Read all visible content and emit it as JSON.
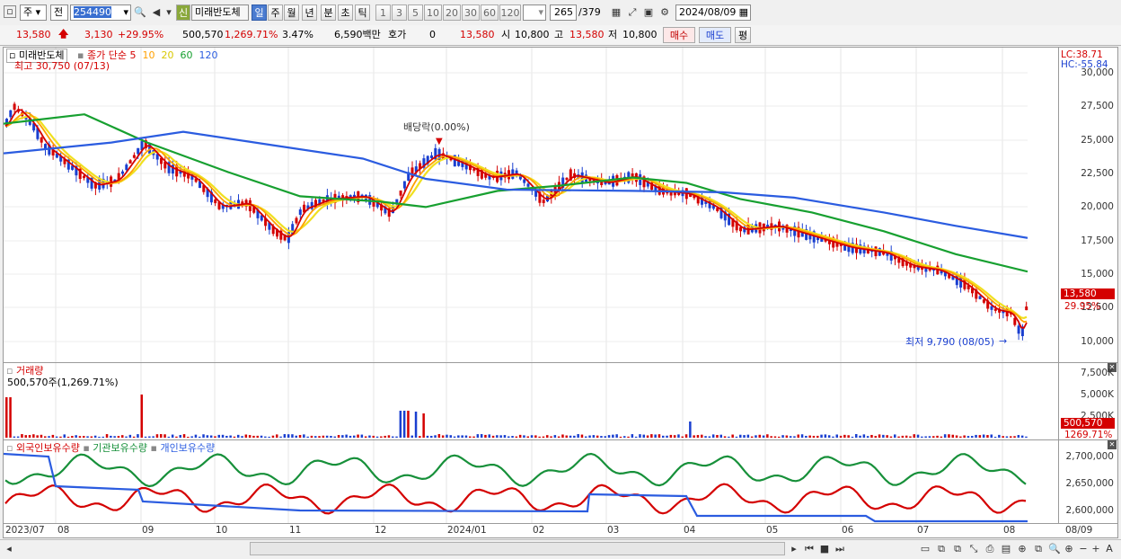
{
  "toolbar1": {
    "period_select": "주",
    "prev_select": "전",
    "stock_code": "254490",
    "stock_name_badge": "신",
    "stock_name": "미래반도체",
    "period_tabs": [
      "일",
      "주",
      "월",
      "년",
      "분",
      "초",
      "틱"
    ],
    "active_period": "일",
    "minute_buttons": [
      "1",
      "3",
      "5",
      "10",
      "20",
      "30",
      "60",
      "120"
    ],
    "count": "265",
    "count_total": "/379",
    "date": "2024/08/09"
  },
  "toolbar2": {
    "price": "13,580",
    "change": "3,130",
    "change_pct": "+29.95%",
    "volume": "500,570",
    "volume_pct": "1,269.71%",
    "turnover": "3.47%",
    "amount": "6,590백만",
    "quote_label": "호가",
    "quote_value": "0",
    "quote_price": "13,580",
    "open_label": "시",
    "open": "10,800",
    "high_label": "고",
    "high": "13,580",
    "low_label": "저",
    "low": "10,800",
    "buy": "매수",
    "sell": "매도",
    "eval": "평"
  },
  "price_panel": {
    "title": "미래반도체",
    "ma_prefix": "종가 단순",
    "ma_periods": [
      "5",
      "10",
      "20",
      "60",
      "120"
    ],
    "high_note": "최고 30,750 (07/13)",
    "dividend_note": "배당락(0.00%)",
    "low_note": "최저 9,790 (08/05)",
    "lc": "LC:38.71",
    "hc": "HC:-55.84",
    "y_ticks": [
      "30,000",
      "27,500",
      "25,000",
      "22,500",
      "20,000",
      "17,500",
      "15,000",
      "12,500",
      "10,000"
    ],
    "last_price_tag": "13,580",
    "last_pct_tag": "29.95%"
  },
  "volume_panel": {
    "title": "거래량",
    "value_note": "500,570주(1,269.71%)",
    "y_ticks": [
      "7,500K",
      "5,000K",
      "2,500K"
    ],
    "last_tag": "500,570",
    "last_pct_tag": "1269.71%"
  },
  "holding_panel": {
    "series": [
      "외국인보유수량",
      "기관보유수량",
      "개인보유수량"
    ],
    "y_ticks": [
      "2,700,000",
      "2,650,000",
      "2,600,000"
    ]
  },
  "x_axis": [
    "2023/07",
    "08",
    "09",
    "10",
    "11",
    "12",
    "2024/01",
    "02",
    "03",
    "04",
    "05",
    "06",
    "07",
    "08",
    "08/09"
  ],
  "colors": {
    "ma5": "#d40000",
    "ma10": "#ffa000",
    "ma20": "#f0e020",
    "ma60": "#17a030",
    "ma120": "#2b5ce0",
    "up": "#d40000",
    "down": "#1a3fd0"
  }
}
